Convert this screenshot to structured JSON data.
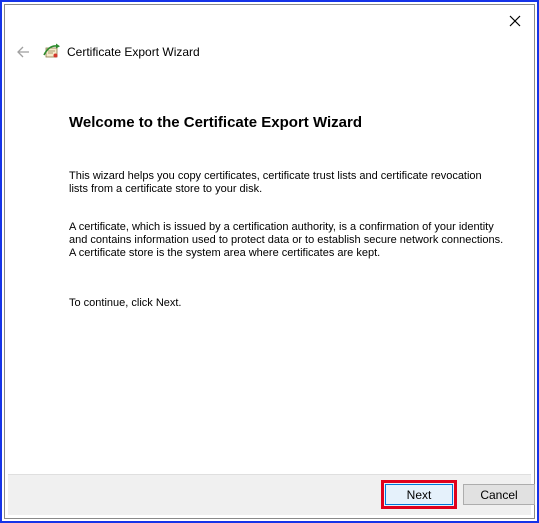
{
  "window": {
    "title": "Certificate Export Wizard",
    "icons": {
      "close": "close-icon",
      "back": "back-arrow-icon",
      "wizard": "certificate-wizard-icon"
    }
  },
  "main": {
    "heading": "Welcome to the Certificate Export Wizard",
    "paragraph1": "This wizard helps you copy certificates, certificate trust lists and certificate revocation lists from a certificate store to your disk.",
    "paragraph2": "A certificate, which is issued by a certification authority, is a confirmation of your identity and contains information used to protect data or to establish secure network connections. A certificate store is the system area where certificates are kept.",
    "paragraph3": "To continue, click Next."
  },
  "footer": {
    "next_label": "Next",
    "cancel_label": "Cancel"
  },
  "colors": {
    "window_border": "#1533e8",
    "highlight": "#e0001b",
    "footer_bg": "#f0f0f0"
  }
}
